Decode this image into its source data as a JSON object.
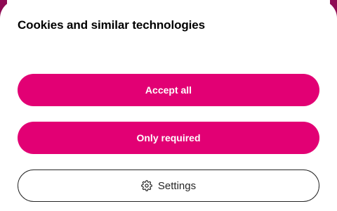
{
  "dialog": {
    "title": "Cookies and similar technologies"
  },
  "buttons": {
    "accept_all": "Accept all",
    "only_required": "Only required",
    "settings": "Settings",
    "settings_icon": "gear-icon"
  },
  "colors": {
    "brand_magenta": "#e20074",
    "backdrop": "#8e0b54",
    "text_dark": "#262626"
  }
}
